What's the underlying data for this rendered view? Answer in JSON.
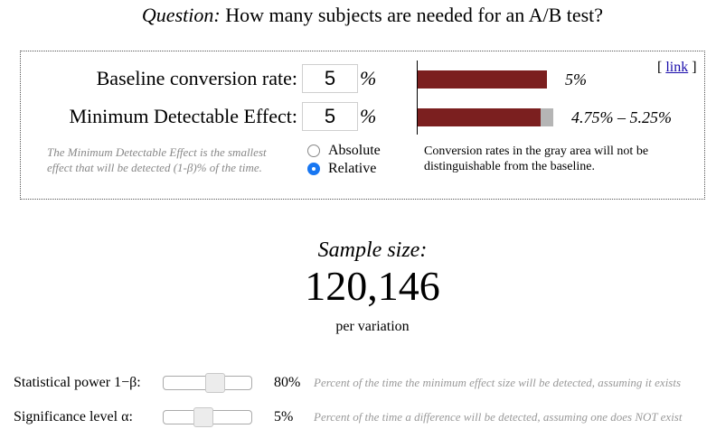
{
  "question": {
    "prefix": "Question:",
    "text": "How many subjects are needed for an A/B test?"
  },
  "link": {
    "open": "[",
    "label": "link",
    "close": "]"
  },
  "baseline": {
    "label": "Baseline conversion rate:",
    "value": "5",
    "unit": "%",
    "bar_label": "5%"
  },
  "mde": {
    "label": "Minimum Detectable Effect:",
    "value": "5",
    "unit": "%",
    "bar_label": "4.75% – 5.25%"
  },
  "mde_note": "The Minimum Detectable Effect is the smallest effect that will be detected (1-β)% of the time.",
  "mode_options": [
    {
      "label": "Absolute",
      "selected": false
    },
    {
      "label": "Relative",
      "selected": true
    }
  ],
  "gray_note": "Conversion rates in the gray area will not be distinguishable from the baseline.",
  "sample_size": {
    "label": "Sample size:",
    "value": "120,146",
    "sub": "per variation"
  },
  "power": {
    "label": "Statistical power 1−β:",
    "value": "80%",
    "level": 0.8,
    "description": "Percent of the time the minimum effect size will be detected, assuming it exists"
  },
  "significance": {
    "label": "Significance level α:",
    "value": "5%",
    "level": 0.05,
    "description": "Percent of the time a difference will be detected, assuming one does NOT exist"
  },
  "colors": {
    "bar": "#7b1f1f",
    "gray_zone": "#b5b5b5",
    "link": "#1a0dab",
    "radio_selected": "#1877f2"
  }
}
